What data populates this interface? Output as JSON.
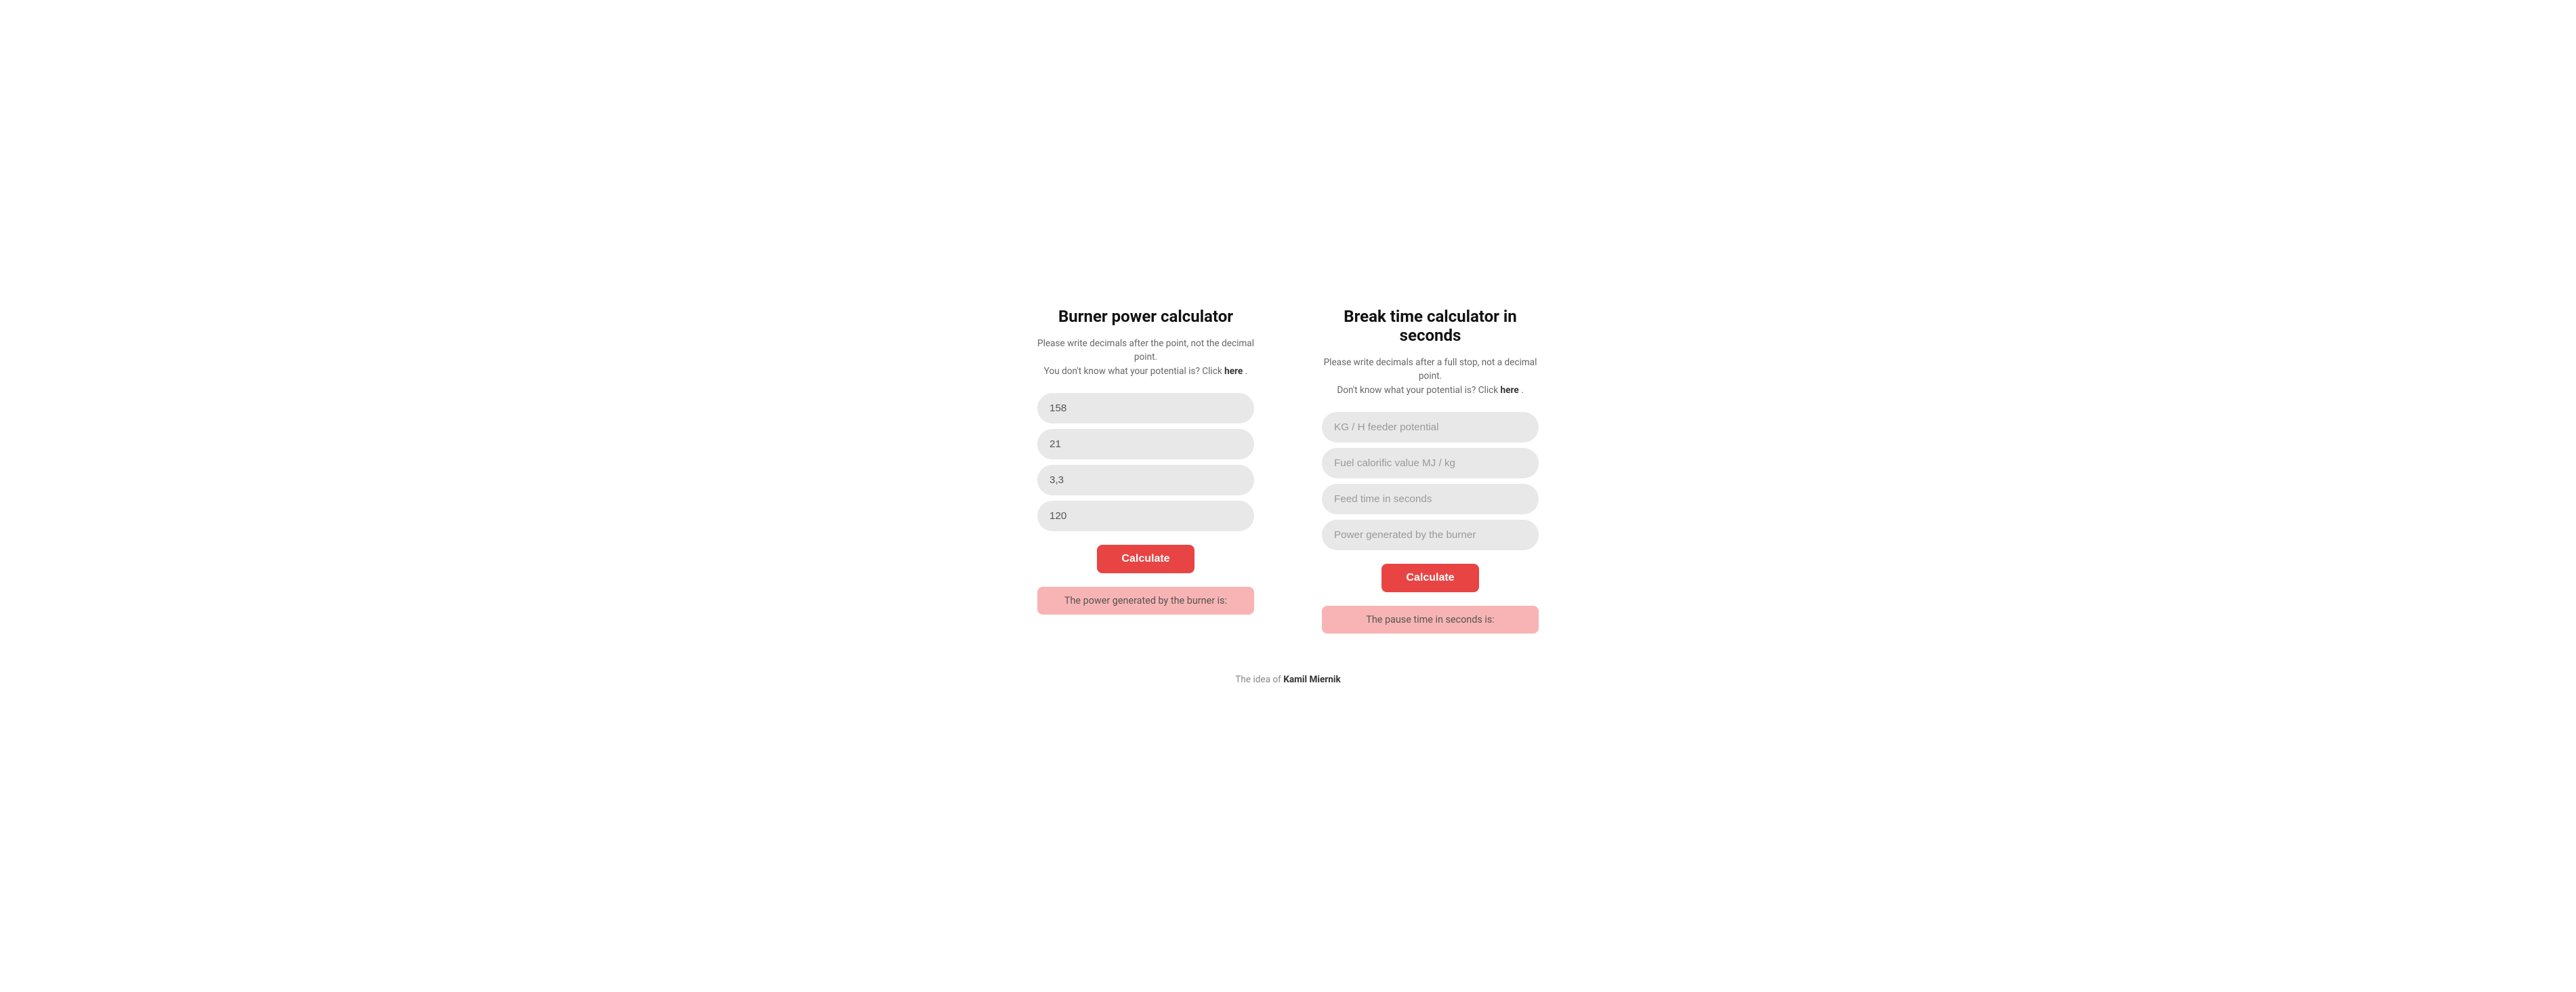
{
  "left_calculator": {
    "title": "Burner power calculator",
    "subtitle_line1": "Please write decimals after the point, not the decimal point.",
    "subtitle_line2": "You don't know what your potential is? Click",
    "subtitle_link": "here",
    "inputs": [
      {
        "id": "input1",
        "value": "158",
        "placeholder": "158"
      },
      {
        "id": "input2",
        "value": "21",
        "placeholder": "21"
      },
      {
        "id": "input3",
        "value": "3,3",
        "placeholder": "3,3"
      },
      {
        "id": "input4",
        "value": "120",
        "placeholder": "120"
      }
    ],
    "button_label": "Calculate",
    "result_label": "The power generated by the burner is:"
  },
  "right_calculator": {
    "title": "Break time calculator in seconds",
    "subtitle_line1": "Please write decimals after a full stop, not a decimal point.",
    "subtitle_line2": "Don't know what your potential is? Click",
    "subtitle_link": "here",
    "inputs": [
      {
        "id": "r_input1",
        "value": "",
        "placeholder": "KG / H feeder potential"
      },
      {
        "id": "r_input2",
        "value": "",
        "placeholder": "Fuel calorific value MJ / kg"
      },
      {
        "id": "r_input3",
        "value": "",
        "placeholder": "Feed time in seconds"
      },
      {
        "id": "r_input4",
        "value": "",
        "placeholder": "Power generated by the burner"
      }
    ],
    "button_label": "Calculate",
    "result_label": "The pause time in seconds is:"
  },
  "footer": {
    "text": "The idea of",
    "author": "Kamil Miernik"
  }
}
